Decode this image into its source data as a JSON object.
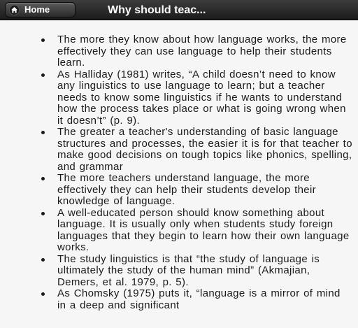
{
  "header": {
    "home_label": "Home",
    "title": "Why should teac...",
    "home_icon": "home-icon"
  },
  "content": {
    "items": [
      {
        "text": "The more they know about how language works, the more effectively they can use language to help their students learn."
      },
      {
        "text": "As Halliday (1981) writes, “A child doesn’t need to know any linguistics to use language to learn; but a teacher needs to know some linguistics if he wants to understand how the process takes place or what is going wrong when it doesn’t” (p. 9)."
      },
      {
        "text": "The greater a teacher's understanding of basic language structures and processes, the easier it is for that teacher to make good decisions on tough topics like phonics, spelling, and grammar"
      },
      {
        "text": "The more teachers understand language, the more effectively they can help their students develop their knowledge of language."
      },
      {
        "text": "A well-educated person should know something about language. It is usually only when students study foreign languages that they begin to learn how their own language works."
      },
      {
        "text": "The study linguistics is that “the study of language is ultimately the study of the human mind” (Akmajian, Demers, et al. 1979, p. 5)."
      },
      {
        "text": "As Chomsky (1975) puts it, “language is a mirror of mind in a deep and significant"
      }
    ]
  }
}
